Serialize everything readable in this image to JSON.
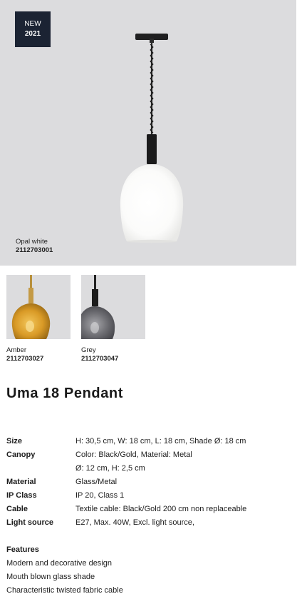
{
  "badge": {
    "line1": "NEW",
    "line2": "2021"
  },
  "hero": {
    "finish": "Opal white",
    "code": "2112703001"
  },
  "variants": [
    {
      "name": "Amber",
      "code": "2112703027"
    },
    {
      "name": "Grey",
      "code": "2112703047"
    }
  ],
  "product": {
    "title": "Uma 18 Pendant"
  },
  "specs": {
    "size": {
      "label": "Size",
      "value": "H: 30,5 cm, W: 18 cm, L: 18 cm, Shade Ø: 18 cm"
    },
    "canopy": {
      "label": "Canopy",
      "value": "Color: Black/Gold, Material: Metal",
      "value2": "Ø: 12 cm, H: 2,5 cm"
    },
    "material": {
      "label": "Material",
      "value": "Glass/Metal"
    },
    "ip": {
      "label": "IP Class",
      "value": "IP 20, Class 1"
    },
    "cable": {
      "label": "Cable",
      "value": "Textile cable: Black/Gold 200 cm non replaceable"
    },
    "light": {
      "label": "Light source",
      "value": "E27, Max. 40W, Excl. light source,"
    }
  },
  "features": {
    "title": "Features",
    "items": [
      "Modern and decorative design",
      "Mouth blown glass shade",
      "Characteristic twisted fabric cable"
    ]
  },
  "colors": {
    "badge_bg": "#1b2333",
    "photo_bg": "#dcdcde"
  }
}
